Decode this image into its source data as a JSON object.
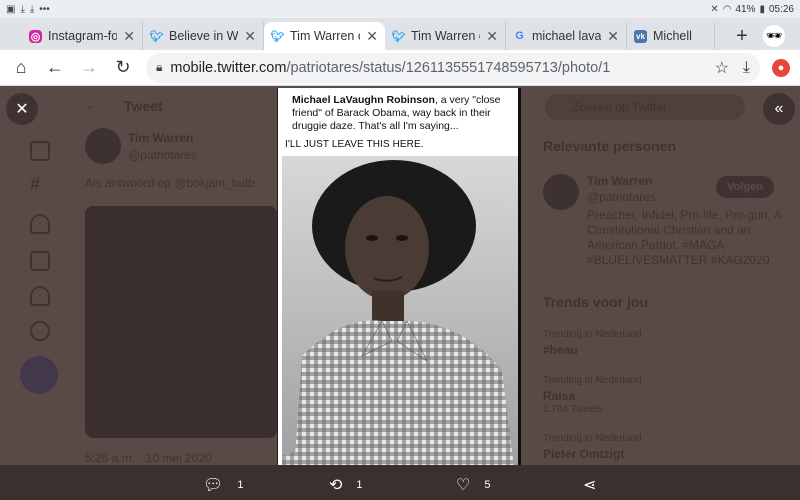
{
  "statusbar": {
    "battery": "41%",
    "time": "05:26"
  },
  "tabs": [
    {
      "title": "Instagram-fot",
      "favicon": "instagram-icon",
      "color": "#d6249f"
    },
    {
      "title": "Believe in Wh",
      "favicon": "twitter-icon",
      "color": "#1da1f2"
    },
    {
      "title": "Tim Warren o",
      "favicon": "twitter-icon",
      "color": "#1da1f2"
    },
    {
      "title": "Tim Warren o",
      "favicon": "twitter-icon",
      "color": "#1da1f2"
    },
    {
      "title": "michael lavau",
      "favicon": "google-icon",
      "color": "#4285f4"
    },
    {
      "title": "Michell",
      "favicon": "vk-icon",
      "color": "#4a76a8"
    }
  ],
  "address": {
    "domain": "mobile.twitter.com",
    "path": "/patriotares/status/1261135551748595713/photo/1"
  },
  "background": {
    "header": "Tweet",
    "author_name": "Tim Warren",
    "author_handle": "@patriotares",
    "replying": "Als antwoord op @bokjam_bulb",
    "search_placeholder": "Zoeken op Twitter",
    "relevant_title": "Relevante personen",
    "rel_name": "Tim Warren",
    "rel_handle": "@patriotares",
    "follow_label": "Volgen",
    "bio": [
      "Preacher, Infidel, Pro-life, Pro-gun, A",
      "Constitutional Christian and an",
      "American Patriot. #MAGA",
      "#BLUELIVESMATTER #KAG2020"
    ],
    "trends_title": "Trends voor jou",
    "trends": [
      {
        "meta": "Trending in Nederland",
        "name": "#beau"
      },
      {
        "meta": "Trending in Nederland",
        "name": "Raisa",
        "count": "1.784 Tweets"
      },
      {
        "meta": "Trending in Nederland",
        "name": "Pieter Omtzigt"
      }
    ],
    "timestamp": "5:25 a.m. · 10 mei 2020"
  },
  "photo_caption": {
    "name": "Michael LaVaughn Robinson",
    "text": ", a very \"close friend\" of Barack Obama, way back in their druggie daze. That's all I'm saying...",
    "line2": "I'LL JUST LEAVE THIS HERE."
  },
  "actions": {
    "replies": "1",
    "retweets": "1",
    "likes": "5"
  }
}
